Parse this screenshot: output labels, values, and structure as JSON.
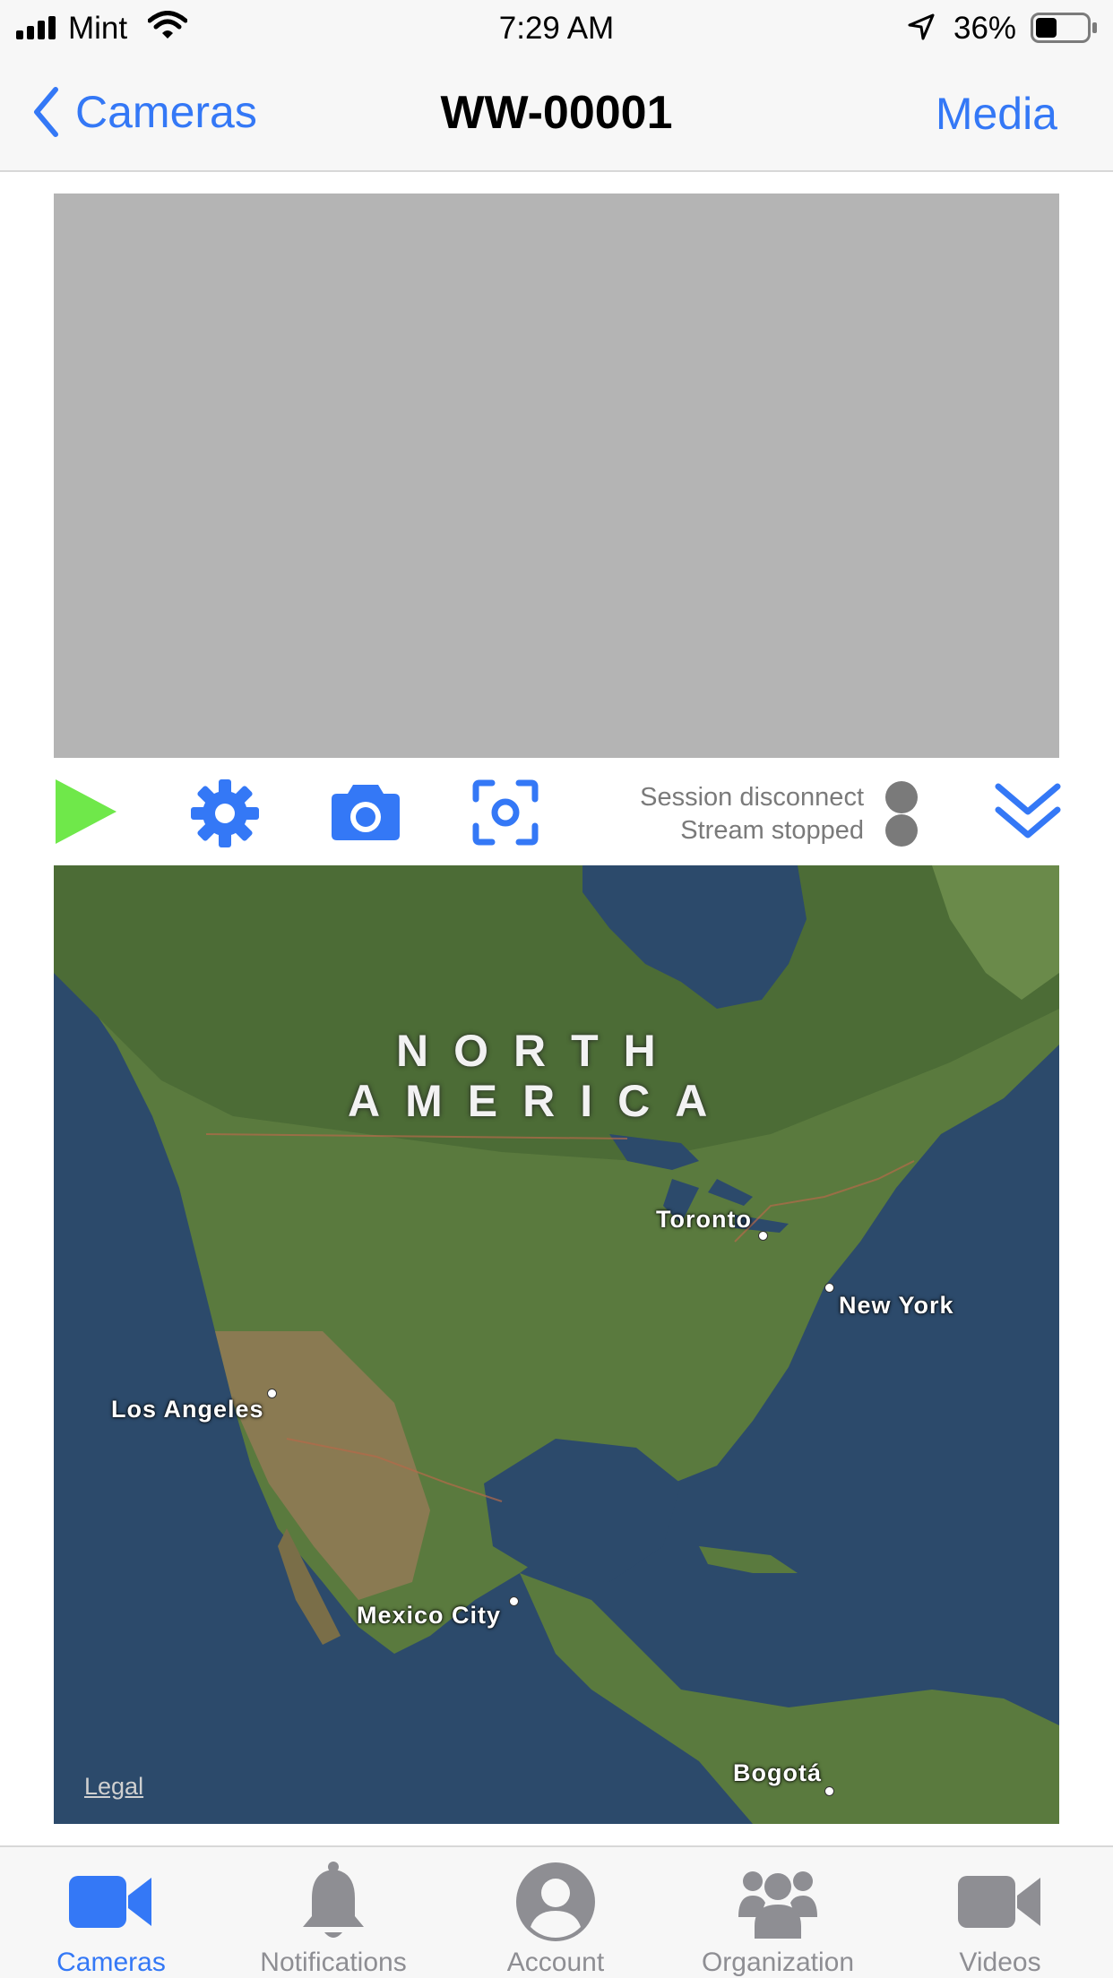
{
  "status_bar": {
    "carrier": "Mint",
    "time": "7:29 AM",
    "battery": "36%"
  },
  "nav": {
    "back_label": "Cameras",
    "title": "WW-00001",
    "right_label": "Media"
  },
  "controls": {
    "session_status": "Session disconnect",
    "stream_status": "Stream stopped"
  },
  "map": {
    "region_line1": "NORTH",
    "region_line2": "AMERICA",
    "cities": {
      "toronto": "Toronto",
      "new_york": "New York",
      "los_angeles": "Los Angeles",
      "mexico_city": "Mexico City",
      "bogota": "Bogotá"
    },
    "legal": "Legal"
  },
  "tabs": [
    {
      "label": "Cameras",
      "icon": "video-camera-icon",
      "active": true
    },
    {
      "label": "Notifications",
      "icon": "bell-icon",
      "active": false
    },
    {
      "label": "Account",
      "icon": "account-icon",
      "active": false
    },
    {
      "label": "Organization",
      "icon": "organization-icon",
      "active": false
    },
    {
      "label": "Videos",
      "icon": "video-camera-icon",
      "active": false
    }
  ],
  "colors": {
    "accent": "#3478f6",
    "play": "#6fe84a",
    "tab_inactive": "#8e8e93",
    "status_gray": "#7a7a7a"
  }
}
